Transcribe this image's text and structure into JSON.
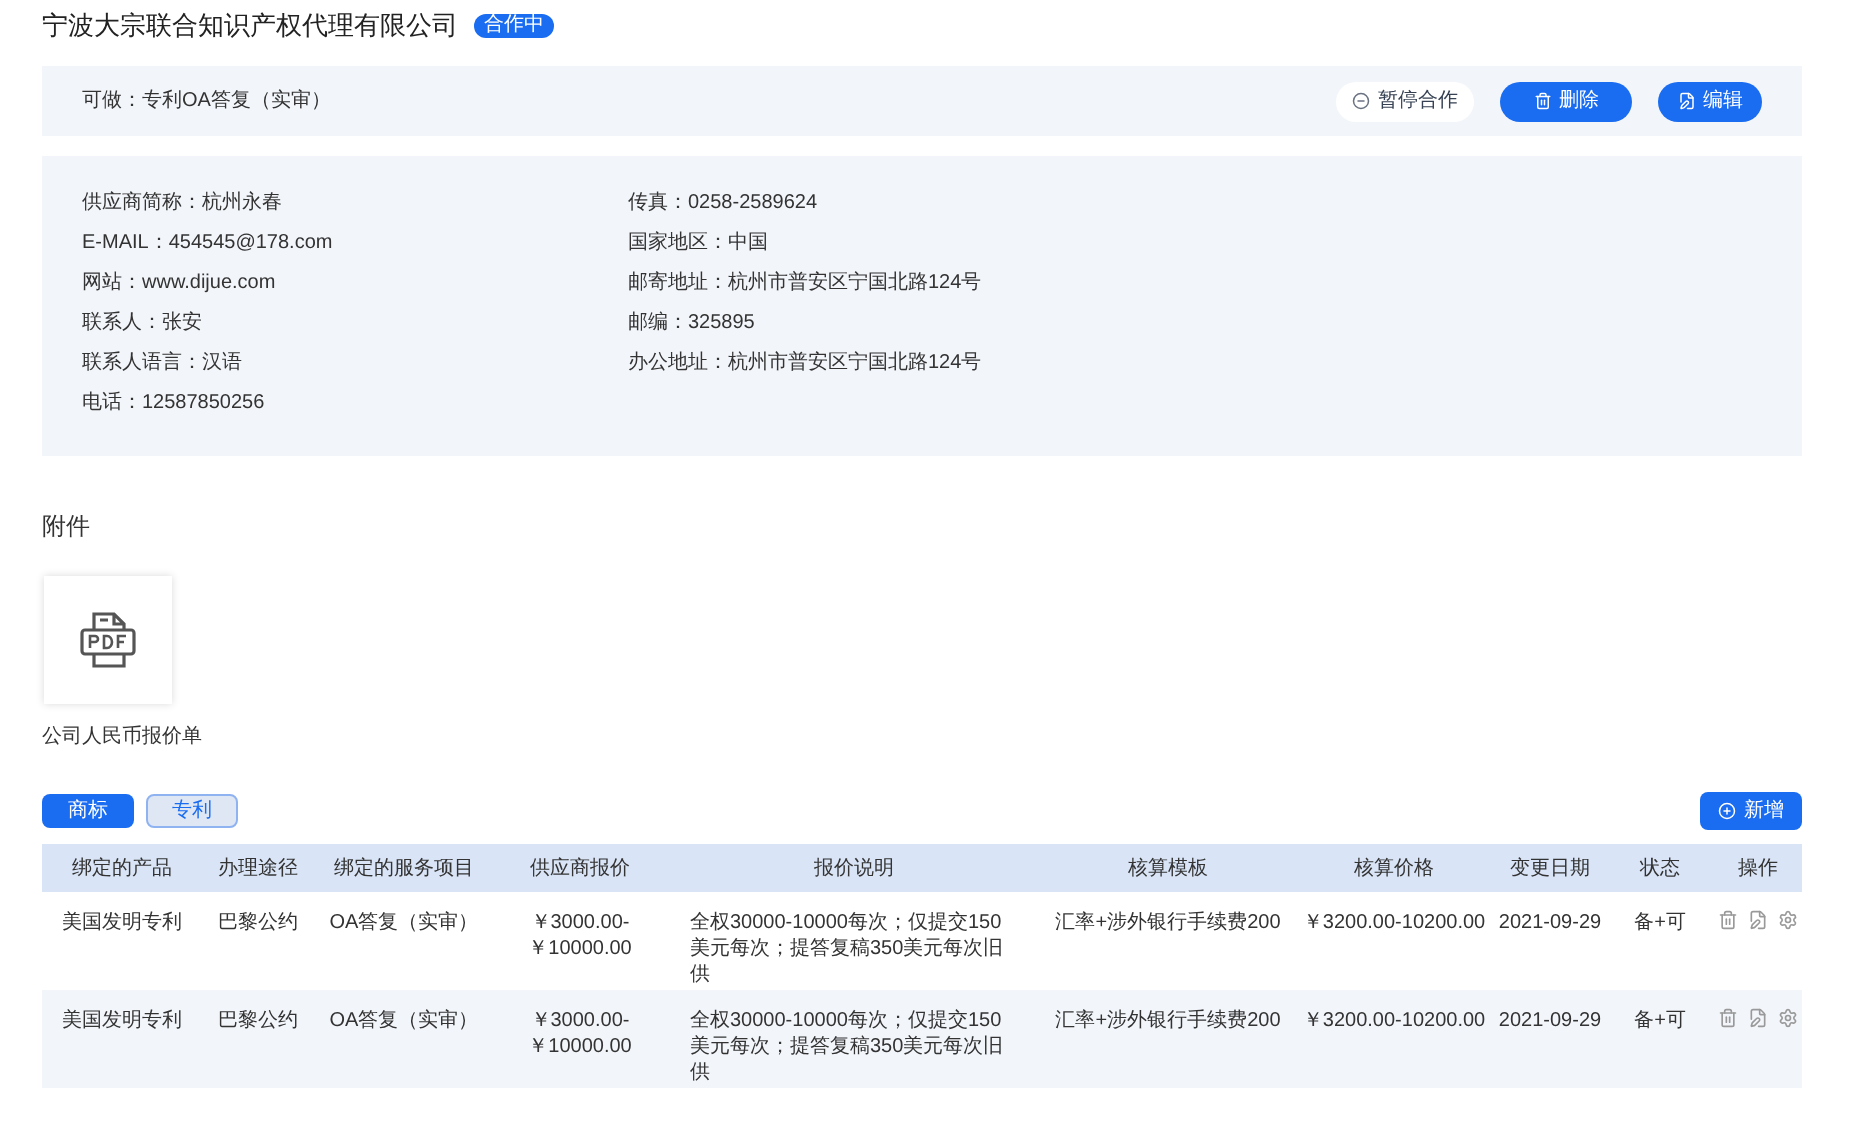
{
  "header": {
    "title": "宁波大宗联合知识产权代理有限公司",
    "badge": "合作中"
  },
  "action_bar": {
    "note": "可做：专利OA答复（实审）",
    "buttons": [
      {
        "kind": "outline",
        "label": "暂停合作"
      },
      {
        "kind": "delete",
        "label": "删除"
      },
      {
        "kind": "edit",
        "label": "编辑"
      }
    ]
  },
  "info": {
    "left": [
      "供应商简称：杭州永春",
      "E-MAIL：454545@178.com",
      "网站：www.dijue.com",
      "联系人：张安",
      "联系人语言：汉语",
      "电话：12587850256"
    ],
    "right": [
      "传真：0258-2589624",
      "国家地区：中国",
      "邮寄地址：杭州市普安区宁国北路124号",
      "邮编：325895",
      "办公地址：杭州市普安区宁国北路124号"
    ]
  },
  "attachments": {
    "title": "附件",
    "files": [
      {
        "name": "公司人民币报价单"
      }
    ]
  },
  "tabs": [
    {
      "label": "商标",
      "selected": true
    },
    {
      "label": "专利",
      "selected": false
    }
  ],
  "add_button": "新增",
  "table": {
    "columns": [
      "绑定的产品",
      "办理途径",
      "绑定的服务项目",
      "供应商报价",
      "报价说明",
      "核算模板",
      "核算价格",
      "变更日期",
      "状态",
      "操作"
    ],
    "rows": [
      {
        "cells": [
          "美国发明专利",
          "巴黎公约",
          "OA答复（实审）",
          "￥3000.00-￥10000.00",
          "全权30000-10000每次；仅提交150美元每次；提答复稿350美元每次旧供",
          "汇率+涉外银行手续费200",
          "￥3200.00-10200.00",
          "2021-09-29",
          "备+可"
        ]
      },
      {
        "cells": [
          "美国发明专利",
          "巴黎公约",
          "OA答复（实审）",
          "￥3000.00-￥10000.00",
          "全权30000-10000每次；仅提交150美元每次；提答复稿350美元每次旧供",
          "汇率+涉外银行手续费200",
          "￥3200.00-10200.00",
          "2021-09-29",
          "备+可"
        ]
      }
    ]
  }
}
